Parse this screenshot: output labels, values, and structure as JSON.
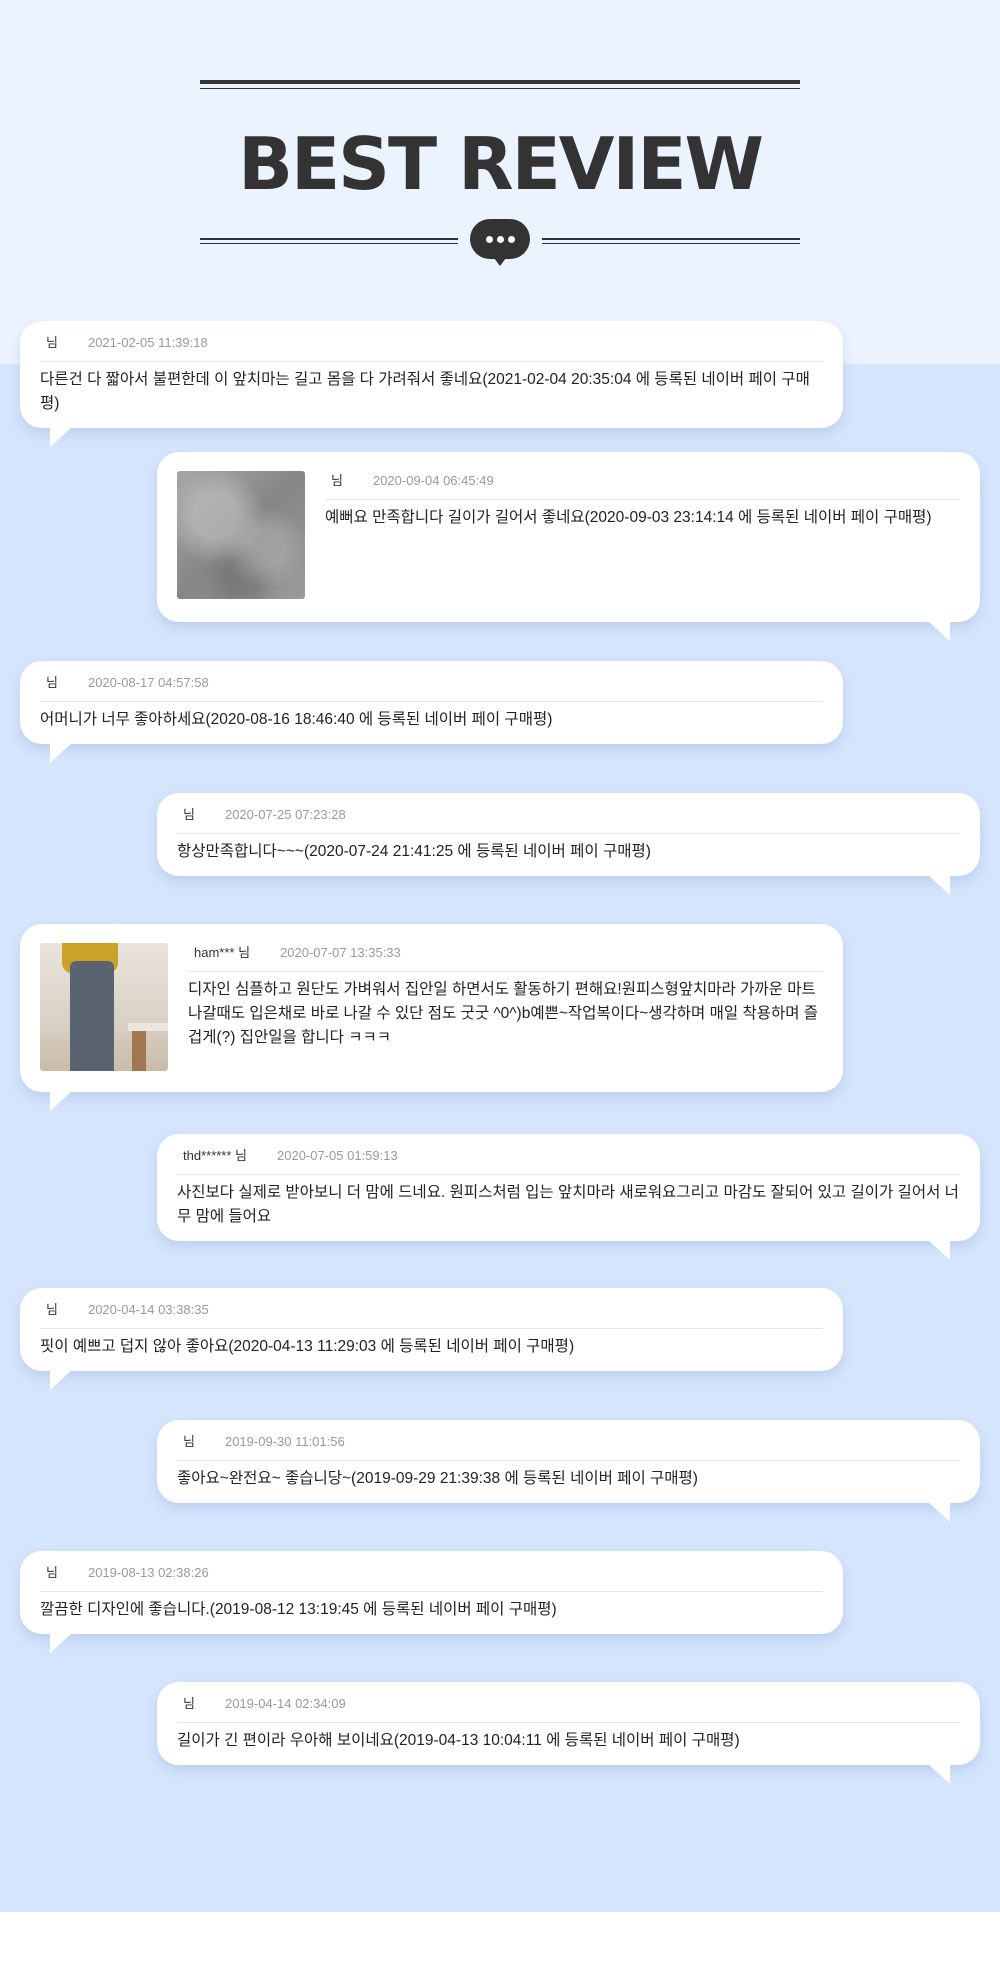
{
  "header": {
    "title": "BEST REVIEW"
  },
  "reviews": [
    {
      "author": "님",
      "date": "2021-02-05 11:39:18",
      "content": "다른건 다 짧아서 불편한데 이 앞치마는 길고 몸을 다 가려줘서 좋네요(2021-02-04 20:35:04 에 등록된 네이버 페이 구매평)"
    },
    {
      "author": "님",
      "date": "2020-09-04 06:45:49",
      "content": "예뻐요 만족합니다 길이가 길어서 좋네요(2020-09-03 23:14:14 에 등록된 네이버 페이 구매평)"
    },
    {
      "author": "님",
      "date": "2020-08-17 04:57:58",
      "content": "어머니가 너무 좋아하세요(2020-08-16 18:46:40 에 등록된 네이버 페이 구매평)"
    },
    {
      "author": "님",
      "date": "2020-07-25 07:23:28",
      "content": "항상만족합니다~~~(2020-07-24 21:41:25 에 등록된 네이버 페이 구매평)"
    },
    {
      "author": "ham*** 님",
      "date": "2020-07-07 13:35:33",
      "content": "디자인 심플하고 원단도 가벼워서 집안일 하면서도 활동하기 편해요!원피스형앞치마라 가까운 마트 나갈때도 입은채로 바로 나갈 수 있단 점도 굿굿 ^0^)b예쁜~작업복이다~생각하며 매일 착용하며 즐겁게(?) 집안일을 합니다 ㅋㅋㅋ"
    },
    {
      "author": "thd****** 님",
      "date": "2020-07-05 01:59:13",
      "content": "사진보다 실제로 받아보니 더 맘에 드네요. 원피스처럼 입는 앞치마라 새로워요그리고 마감도 잘되어 있고 길이가 길어서 너무 맘에 들어요"
    },
    {
      "author": "님",
      "date": "2020-04-14 03:38:35",
      "content": "핏이 예쁘고 덥지 않아 좋아요(2020-04-13 11:29:03 에 등록된 네이버 페이 구매평)"
    },
    {
      "author": "님",
      "date": "2019-09-30 11:01:56",
      "content": "좋아요~완전요~ 좋습니당~(2019-09-29 21:39:38 에 등록된 네이버 페이 구매평)"
    },
    {
      "author": "님",
      "date": "2019-08-13 02:38:26",
      "content": "깔끔한 디자인에 좋습니다.(2019-08-12 13:19:45 에 등록된 네이버 페이 구매평)"
    },
    {
      "author": "님",
      "date": "2019-04-14 02:34:09",
      "content": "길이가 긴 편이라 우아해 보이네요(2019-04-13 10:04:11 에 등록된 네이버 페이 구매평)"
    }
  ]
}
